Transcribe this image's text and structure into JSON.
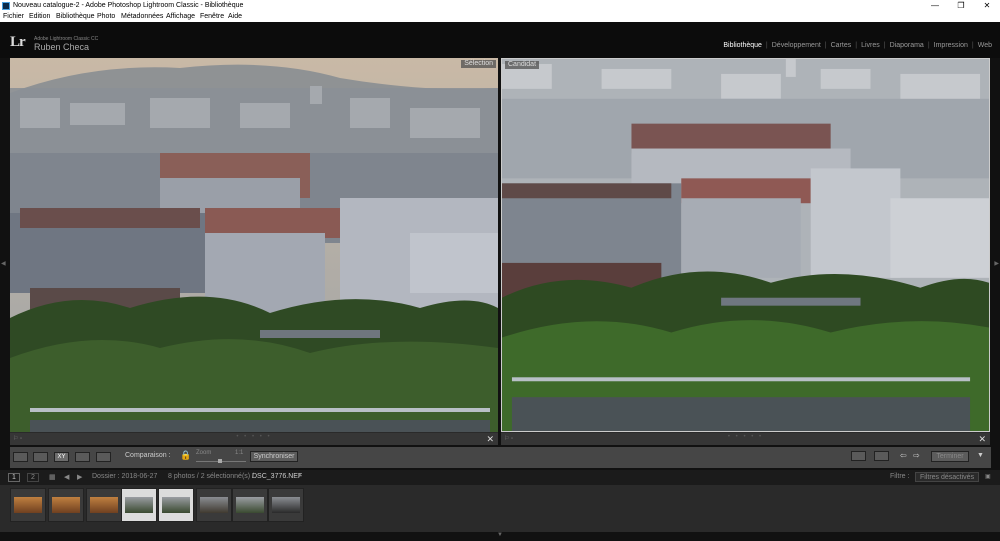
{
  "window": {
    "title": "Nouveau catalogue-2 - Adobe Photoshop Lightroom Classic - Bibliothèque",
    "minimize": "—",
    "maximize": "❐",
    "close": "✕"
  },
  "menu": [
    "Fichier",
    "Edition",
    "Bibliothèque",
    "Photo",
    "Métadonnées",
    "Affichage",
    "Fenêtre",
    "Aide"
  ],
  "identity": {
    "logo": "Lr",
    "product": "Adobe Lightroom Classic CC",
    "user": "Ruben Checa"
  },
  "modules": [
    "Bibliothèque",
    "Développement",
    "Cartes",
    "Livres",
    "Diaporama",
    "Impression",
    "Web"
  ],
  "active_module": "Bibliothèque",
  "viewer": {
    "left_label": "Sélection",
    "right_label": "Candidat"
  },
  "toolbar": {
    "compare_label": "Comparaison :",
    "zoom_label": "Zoom",
    "ratio_label": "1:1",
    "sync_button": "Synchroniser",
    "done_button": "Terminer"
  },
  "filmstrip_header": {
    "page1": "1",
    "page2": "2",
    "folder_info": "Dossier : 2018-06-27",
    "count_info": "8 photos / 2 sélectionné(s) /",
    "filename": "DSC_3776.NEF",
    "filter_label": "Filtre :",
    "filter_value": "Filtres désactivés"
  },
  "thumbnails": [
    {
      "selected": false,
      "tone": "sunset"
    },
    {
      "selected": false,
      "tone": "sunset"
    },
    {
      "selected": false,
      "tone": "sunset"
    },
    {
      "selected": true,
      "tone": "city"
    },
    {
      "selected": true,
      "tone": "city"
    },
    {
      "selected": false,
      "tone": "city"
    },
    {
      "selected": false,
      "tone": "city"
    },
    {
      "selected": false,
      "tone": "city"
    }
  ],
  "colors": {
    "bg": "#111111",
    "panel": "#464646",
    "accent": "#ffffff"
  }
}
